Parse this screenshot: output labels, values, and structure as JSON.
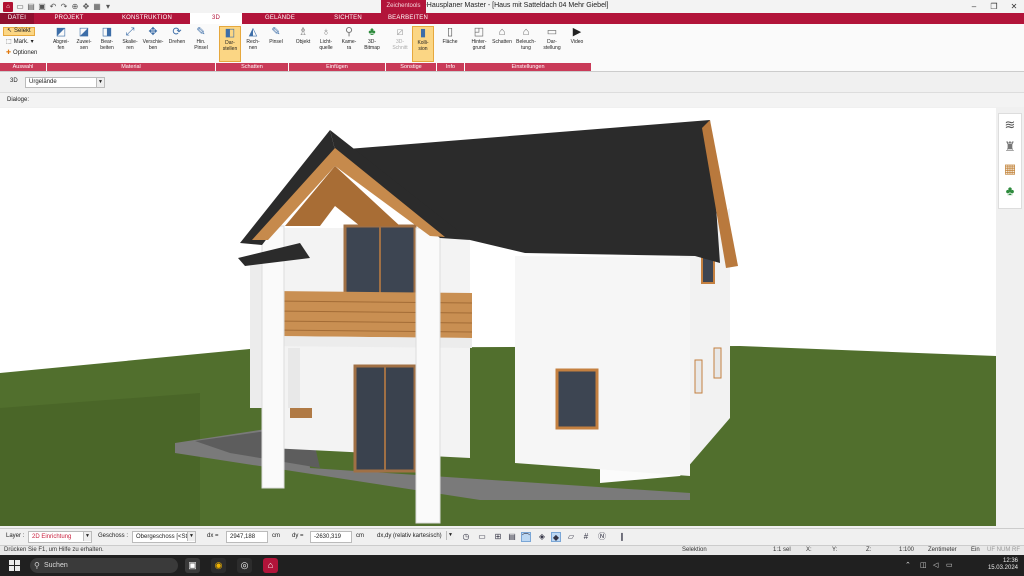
{
  "window": {
    "title": "3D-Hausplaner Master - [Haus mit Satteldach 04 Mehr Giebel]",
    "context_tab": "Zeichentools",
    "buttons": [
      "–",
      "❐",
      "✕"
    ]
  },
  "ribbon_tabs": [
    "DATEI",
    "PROJEKT",
    "KONSTRUKTION",
    "3D",
    "GELÄNDE",
    "SICHTEN",
    "BEARBEITEN"
  ],
  "ribbon": {
    "auswahl": {
      "label": "Auswahl",
      "selekt": "Selekt",
      "mark": "Mark.",
      "optionen": "Optionen"
    },
    "material": {
      "label": "Material",
      "buttons": [
        "Abgrei-\nfen",
        "Zuwei-\nsen",
        "Bear-\nbeiten",
        "Skalie-\nren",
        "Verschie-\nben",
        "Drehen",
        "Hin.\nPinsel"
      ]
    },
    "schatten": {
      "label": "Schatten",
      "buttons": [
        "Dar-\nstellen",
        "Rech-\nnen",
        "Pinsel"
      ]
    },
    "einfuegen": {
      "label": "Einfügen",
      "buttons": [
        "Objekt",
        "Licht-\nquelle",
        "Kame-\nra",
        "3D-\nBitmap"
      ]
    },
    "sonstige": {
      "label": "Sonstige",
      "buttons": [
        "3D-\nSchnitt",
        "Kolli-\nsion"
      ]
    },
    "info": {
      "label": "Info",
      "buttons": [
        "Fläche"
      ]
    },
    "einstellungen": {
      "label": "Einstellungen",
      "buttons": [
        "Hinter-\ngrund",
        "Schatten",
        "Beleuch-\ntung",
        "Dar-\nstellung",
        "Video"
      ]
    }
  },
  "layer_row": {
    "label": "3D",
    "select": "Urgelände"
  },
  "dialog_label": "Dialoge:",
  "toolbar": {
    "layer_label": "Layer :",
    "layer_value": "2D Einrichtung",
    "geschoss_label": "Geschoss :",
    "geschoss_value": "Obergeschoss [<St",
    "dx_label": "dx =",
    "dx_value": "2947,188",
    "dx_unit": "cm",
    "dy_label": "dy =",
    "dy_value": "-2630,319",
    "dy_unit": "cm",
    "mode_value": "dx,dy (relativ kartesisch)"
  },
  "statusbar": {
    "help": "Drücken Sie F1, um Hilfe zu erhalten.",
    "mode": "Selektion",
    "scale": "1:1 sel",
    "x": "X:",
    "y": "Y:",
    "z": "Z:",
    "zoom": "1:100",
    "unit": "Zentimeter",
    "ein": "Ein",
    "flags": "UF NUM RF"
  },
  "taskbar": {
    "search_placeholder": "Suchen",
    "time": "12:36",
    "date": "15.03.2024"
  },
  "colors": {
    "accent": "#b2143a",
    "group_label": "#c93a58",
    "active_button": "#fbd684",
    "roof": "#2b2b2b",
    "wall": "#f4f4f4",
    "wood": "#c48a4c",
    "grass": "#4f6d2c"
  }
}
